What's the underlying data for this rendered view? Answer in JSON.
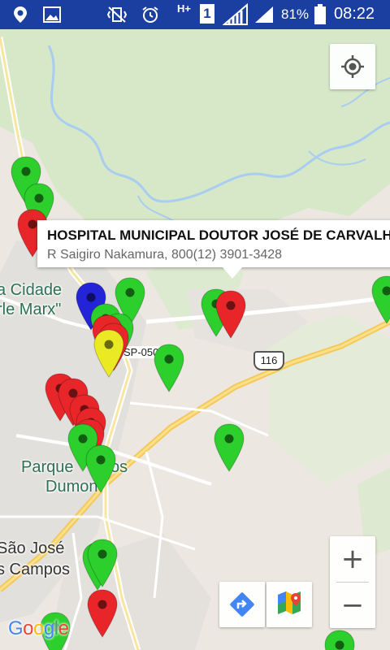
{
  "status_bar": {
    "battery_percent": "81%",
    "time": "08:22",
    "network_type": "H+",
    "sim_slot": "1",
    "icons": [
      "location-icon",
      "image-icon",
      "vibrate-icon",
      "alarm-icon",
      "signal-icon",
      "signal-icon",
      "battery-icon"
    ]
  },
  "map": {
    "place_labels": {
      "cidade_line1": "a Cidade",
      "cidade_line2": "rle Marx\"",
      "parque_line1": "Parque",
      "parque_line1b": "os",
      "parque_line2": "Dumon",
      "sjc_line1": "São José",
      "sjc_line2": "s Campos"
    },
    "road_labels": {
      "sp050": "SP-050",
      "br116": "116"
    },
    "info_window": {
      "title": "HOSPITAL MUNICIPAL DOUTOR JOSÉ DE CARVALHO",
      "snippet": "R Saigiro Nakamura, 800(12) 3901-3428"
    },
    "marker_colors": {
      "green": "#2ccf2c",
      "red": "#e8262a",
      "blue": "#2323d8",
      "yellow": "#e9ea24"
    },
    "markers": [
      {
        "color": "green"
      },
      {
        "color": "green"
      },
      {
        "color": "red"
      },
      {
        "color": "green"
      },
      {
        "color": "blue"
      },
      {
        "color": "green"
      },
      {
        "color": "green"
      },
      {
        "color": "red"
      },
      {
        "color": "red"
      },
      {
        "color": "yellow"
      },
      {
        "color": "green"
      },
      {
        "color": "green"
      },
      {
        "color": "red"
      },
      {
        "color": "green"
      },
      {
        "color": "red"
      },
      {
        "color": "red"
      },
      {
        "color": "red"
      },
      {
        "color": "red"
      },
      {
        "color": "red"
      },
      {
        "color": "green"
      },
      {
        "color": "green"
      },
      {
        "color": "green"
      },
      {
        "color": "green"
      },
      {
        "color": "green"
      },
      {
        "color": "red"
      },
      {
        "color": "green"
      },
      {
        "color": "green"
      }
    ],
    "controls": {
      "my_location_icon": "my-location-icon",
      "zoom_in_label": "+",
      "zoom_out_label": "−",
      "directions_icon": "directions-icon",
      "open_maps_icon": "google-maps-icon"
    },
    "logo": {
      "letters": [
        "G",
        "o",
        "o",
        "g",
        "l",
        "e"
      ],
      "colors": [
        "#4285F4",
        "#EA4335",
        "#FBBC05",
        "#4285F4",
        "#34A853",
        "#EA4335"
      ]
    }
  }
}
